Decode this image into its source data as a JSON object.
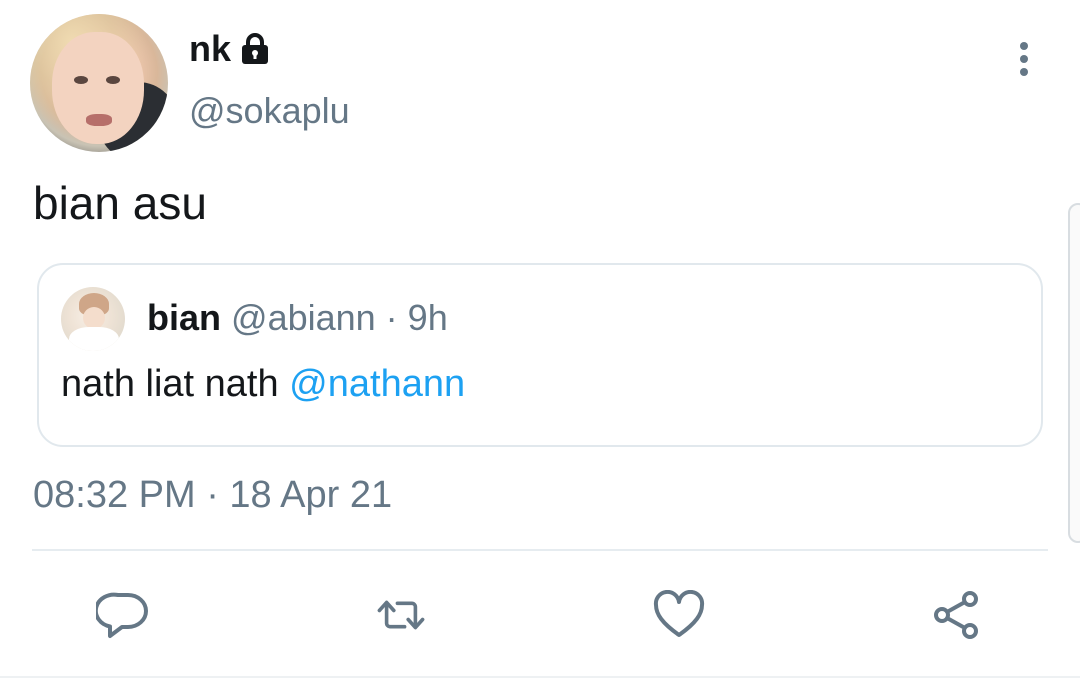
{
  "tweet": {
    "display_name": "nk",
    "handle": "@sokaplu",
    "text": "bian asu",
    "timestamp": "08:32 PM · 18 Apr 21"
  },
  "quoted": {
    "name": "bian",
    "meta": "@abiann · 9h",
    "text": "nath liat nath ",
    "mention": "@nathann"
  },
  "icons": {
    "lock": "lock-icon",
    "more": "more-vertical-icon",
    "reply": "reply-icon",
    "retweet": "retweet-icon",
    "like": "heart-icon",
    "share": "share-icon"
  },
  "colors": {
    "text": "#14171a",
    "secondary": "#657786",
    "mention": "#1da1f2",
    "border": "#e1e8ed"
  }
}
